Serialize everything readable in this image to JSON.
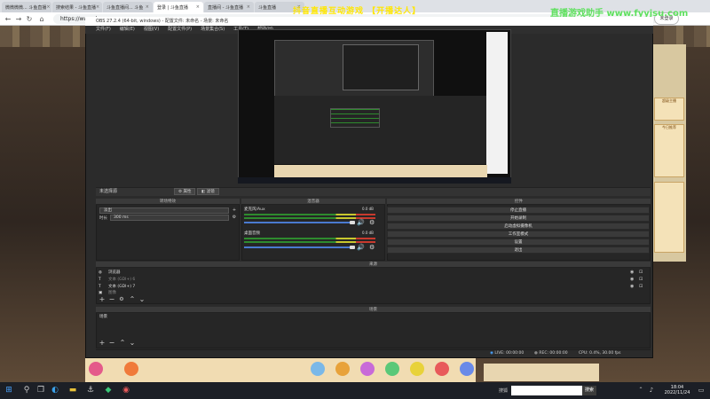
{
  "browser": {
    "tabs": [
      {
        "label": "微微微微... 斗鱼直播",
        "active": false
      },
      {
        "label": "搜索结果 - 斗鱼直播",
        "active": false
      },
      {
        "label": "斗鱼直播间... 斗鱼",
        "active": false
      },
      {
        "label": "登录 | 斗鱼直播",
        "active": true
      },
      {
        "label": "直播间 - 斗鱼直播",
        "active": false
      },
      {
        "label": "斗鱼直播",
        "active": false
      }
    ],
    "url": "https://www.douyu.com",
    "overlay_text_1": "抖音直播互动游戏 【开播达人】",
    "overlay_text_2": "直播游戏助手 www.fyyjsu.com",
    "login_label": "未登录"
  },
  "obs": {
    "title": "OBS 27.2.4 (64-bit, windows) - 配置文件: 未命名 - 场景: 未命名",
    "menu": [
      "文件(F)",
      "编辑(E)",
      "视图(V)",
      "配置文件(P)",
      "场景集合(S)",
      "工具(T)",
      "帮助(H)"
    ],
    "no_source_label": "未选择源",
    "props_label": "属性",
    "filters_label": "滤镜",
    "transitions": {
      "header": "转场特效",
      "selected": "淡出",
      "duration_label": "时长",
      "duration_value": "300 ms"
    },
    "mixer": {
      "header": "混音器",
      "channels": [
        {
          "name": "麦克风/Aux",
          "db": "0.0 dB"
        },
        {
          "name": "桌面音频",
          "db": "0.0 dB"
        }
      ]
    },
    "controls": {
      "header": "控件",
      "buttons": [
        "停止直播",
        "开始录制",
        "启动虚拟摄像机",
        "工作室模式",
        "设置",
        "退出"
      ]
    },
    "sources": {
      "header": "来源",
      "items": [
        {
          "name": "浏览器",
          "dim": false
        },
        {
          "name": "文本 (GDI+) 6",
          "dim": true
        },
        {
          "name": "文本 (GDI+) 7",
          "dim": false
        },
        {
          "name": "图像",
          "dim": true
        }
      ]
    },
    "scenes": {
      "header": "场景",
      "items": [
        "场景"
      ]
    },
    "status": {
      "live": "LIVE: 00:00:00",
      "rec": "REC: 00:00:00",
      "cpu": "CPU: 0.4%, 30.00 fps"
    }
  },
  "site": {
    "side_text": "超级主播",
    "side_text_2": "今日推荐"
  },
  "taskbar": {
    "search_button": "搜索",
    "search_label": "搜狐",
    "time": "18:04",
    "date": "2022/11/24"
  }
}
